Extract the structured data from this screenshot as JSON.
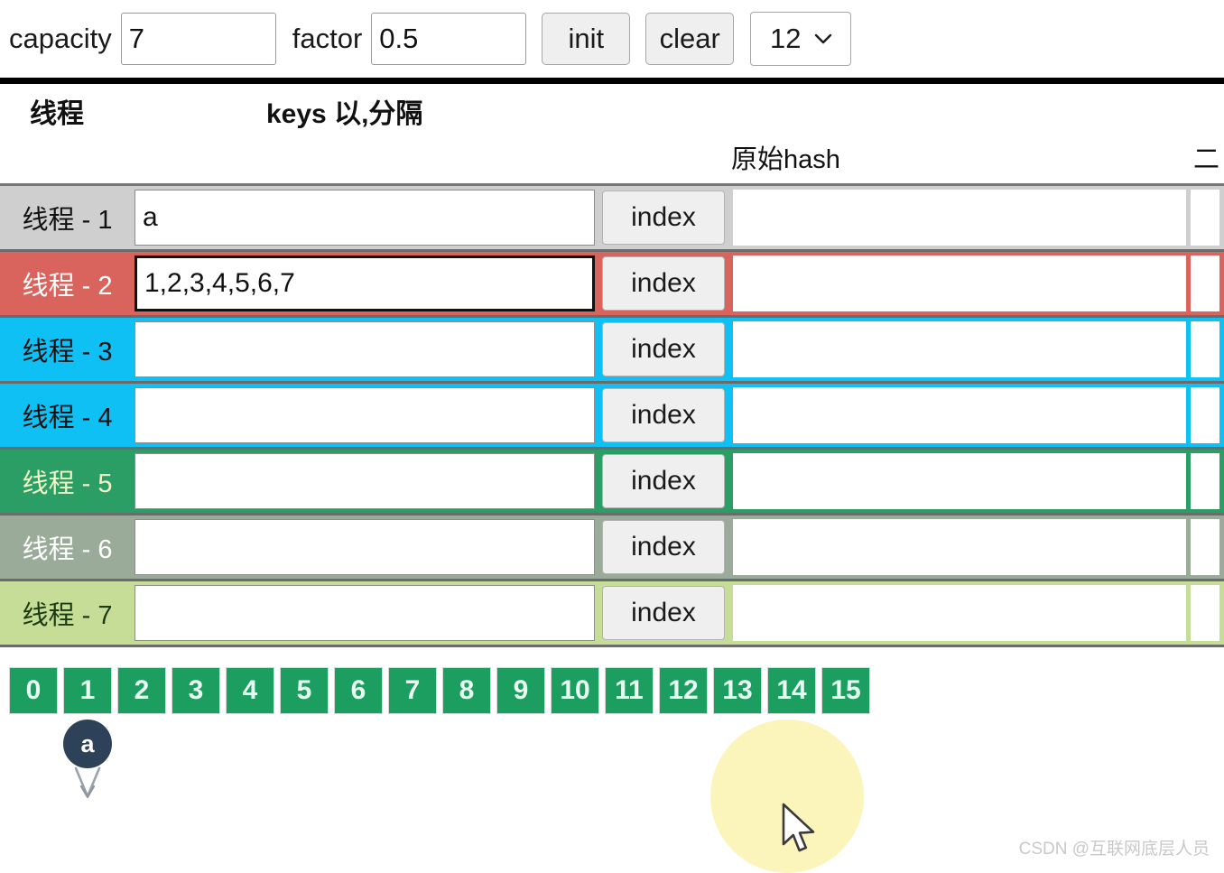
{
  "toolbar": {
    "capacity_label": "capacity",
    "capacity_value": "7",
    "factor_label": "factor",
    "factor_value": "0.5",
    "init_label": "init",
    "clear_label": "clear",
    "size_selected": "12",
    "chevron_icon": "chevron-down-icon"
  },
  "table": {
    "header_thread": "线程",
    "header_keys": "keys 以,分隔",
    "subheader_hash": "原始hash",
    "subheader_second": "二",
    "index_label": "index",
    "rows": [
      {
        "thread": "线程 - 1",
        "keys": "a",
        "index": "index",
        "color": "#cfcfcf",
        "text_color": "#111111",
        "focused": false
      },
      {
        "thread": "线程 - 2",
        "keys": "1,2,3,4,5,6,7",
        "index": "index",
        "color": "#d9635d",
        "text_color": "#ffffff",
        "focused": true
      },
      {
        "thread": "线程 - 3",
        "keys": "",
        "index": "index",
        "color": "#0fc0f5",
        "text_color": "#111111",
        "focused": false
      },
      {
        "thread": "线程 - 4",
        "keys": "",
        "index": "index",
        "color": "#0fc0f5",
        "text_color": "#111111",
        "focused": false
      },
      {
        "thread": "线程 - 5",
        "keys": "",
        "index": "index",
        "color": "#2b9e66",
        "text_color": "#f2f7c8",
        "focused": false
      },
      {
        "thread": "线程 - 6",
        "keys": "",
        "index": "index",
        "color": "#9aab99",
        "text_color": "#ffffff",
        "focused": false
      },
      {
        "thread": "线程 - 7",
        "keys": "",
        "index": "index",
        "color": "#c6dd97",
        "text_color": "#1c3a10",
        "focused": false
      }
    ]
  },
  "buckets": {
    "fill_color": "#1c9e60",
    "cells": [
      "0",
      "1",
      "2",
      "3",
      "4",
      "5",
      "6",
      "7",
      "8",
      "9",
      "10",
      "11",
      "12",
      "13",
      "14",
      "15"
    ]
  },
  "pin": {
    "label": "a",
    "bucket_index": 1,
    "color": "#2d4258"
  },
  "cursor": {
    "icon": "mouse-pointer-icon",
    "halo_color": "#fbf5bb"
  },
  "watermark": {
    "text": "CSDN @互联网底层人员"
  }
}
